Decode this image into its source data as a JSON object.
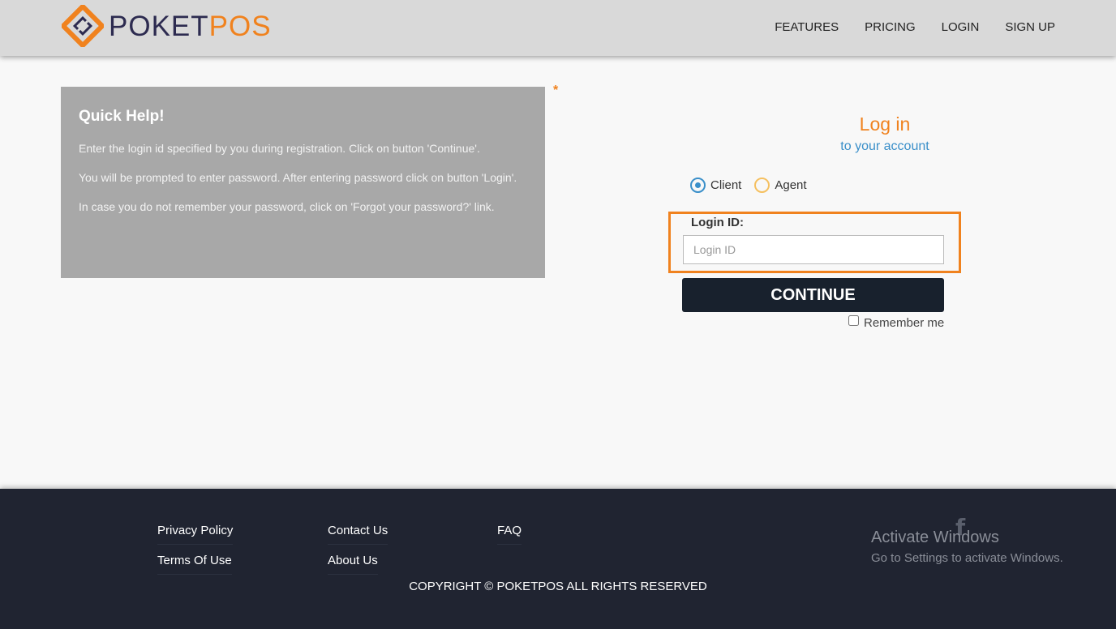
{
  "header": {
    "logo_part1": "POKET",
    "logo_part2": "POS",
    "nav": [
      "FEATURES",
      "PRICING",
      "LOGIN",
      "SIGN UP"
    ]
  },
  "help": {
    "title": "Quick Help!",
    "paragraphs": [
      "Enter the login id specified by you during registration. Click on button 'Continue'.",
      "You will be prompted to enter password. After entering password click on button 'Login'.",
      "In case you do not remember your password, click on 'Forgot your password?' link."
    ],
    "asterisk": "*"
  },
  "login": {
    "title": "Log in",
    "subtitle": "to your account",
    "radio_client": "Client",
    "radio_agent": "Agent",
    "selected": "Client",
    "field_label": "Login ID:",
    "field_placeholder": "Login ID",
    "field_value": "",
    "continue_label": "CONTINUE",
    "remember_label": "Remember me"
  },
  "footer": {
    "links": [
      "Privacy Policy",
      "Contact Us",
      "FAQ",
      "Terms Of Use",
      "About Us"
    ],
    "copyright": "COPYRIGHT © POKETPOS ALL RIGHTS RESERVED",
    "facebook_icon": "f",
    "watermark_line1": "Activate Windows",
    "watermark_line2": "Go to Settings to activate Windows."
  },
  "colors": {
    "accent": "#f0821e",
    "link_blue": "#3a8fc9",
    "dark": "#18212d",
    "footer_bg": "#202431"
  }
}
